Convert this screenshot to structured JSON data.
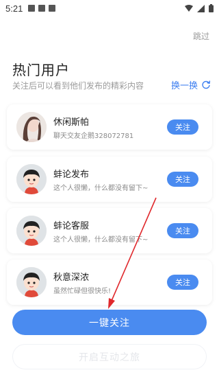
{
  "status_bar": {
    "time": "5:21",
    "icons": [
      "gallery-icon",
      "sim-icon",
      "text-icon",
      "wifi-icon",
      "signal-icon",
      "battery-icon"
    ]
  },
  "header": {
    "skip": "跳过",
    "title": "热门用户",
    "subtitle": "关注后可以看到他们发布的精彩内容",
    "refresh_label": "换一换"
  },
  "users": [
    {
      "name": "休闲斯帕",
      "desc": "聊天交友企鹅328072781",
      "follow": "关注",
      "avatar": "photo-avatar"
    },
    {
      "name": "蚌论发布",
      "desc": "这个人很懒，什么都没有留下~",
      "follow": "关注",
      "avatar": "cartoon-avatar"
    },
    {
      "name": "蚌论客服",
      "desc": "这个人很懒，什么都没有留下~",
      "follow": "关注",
      "avatar": "cartoon-avatar"
    },
    {
      "name": "秋意深浓",
      "desc": "虽然忙碌但很快乐!",
      "follow": "关注",
      "avatar": "cartoon-avatar"
    }
  ],
  "actions": {
    "follow_all": "一键关注",
    "start": "开启互动之旅"
  },
  "colors": {
    "accent": "#4a8bf0",
    "annotation_arrow": "#e0282c"
  }
}
